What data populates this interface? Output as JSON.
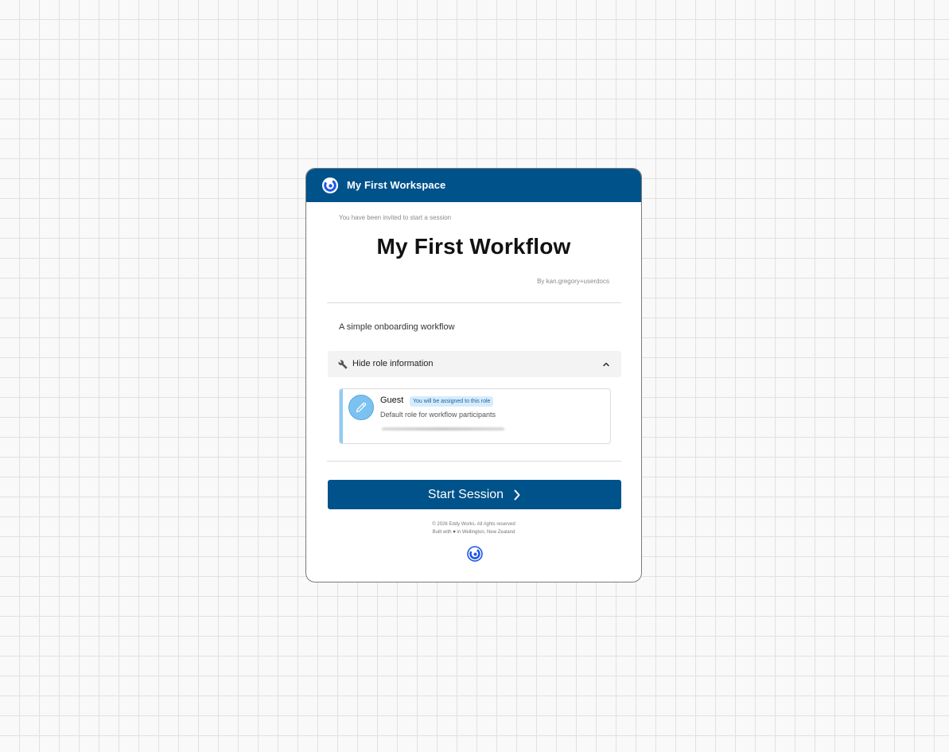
{
  "header": {
    "workspace_name": "My First Workspace",
    "logo_icon": "eddy-works-logo"
  },
  "invite": {
    "message": "You have been invited to start a session"
  },
  "workflow": {
    "title": "My First Workflow",
    "byline": "By kan.gregory+userdocs",
    "description": "A simple onboarding workflow"
  },
  "role_section": {
    "toggle_label": "Hide role information",
    "toggle_icon": "wrench-icon",
    "expand_icon": "chevron-up-icon",
    "role": {
      "name": "Guest",
      "badge": "You will be assigned to this role",
      "description": "Default role for workflow participants",
      "avatar_icon": "pencil-icon",
      "accent_color": "#8ccdf5"
    }
  },
  "action": {
    "start_label": "Start Session"
  },
  "footer": {
    "copyright": "© 2026 Eddy Works. All rights reserved",
    "built_prefix": "Built with",
    "heart": "♥",
    "built_suffix": "in Wellington, New Zealand"
  },
  "colors": {
    "brand": "#00528a",
    "logo_blue": "#1f55e8",
    "badge_bg": "#d6ecfc"
  }
}
